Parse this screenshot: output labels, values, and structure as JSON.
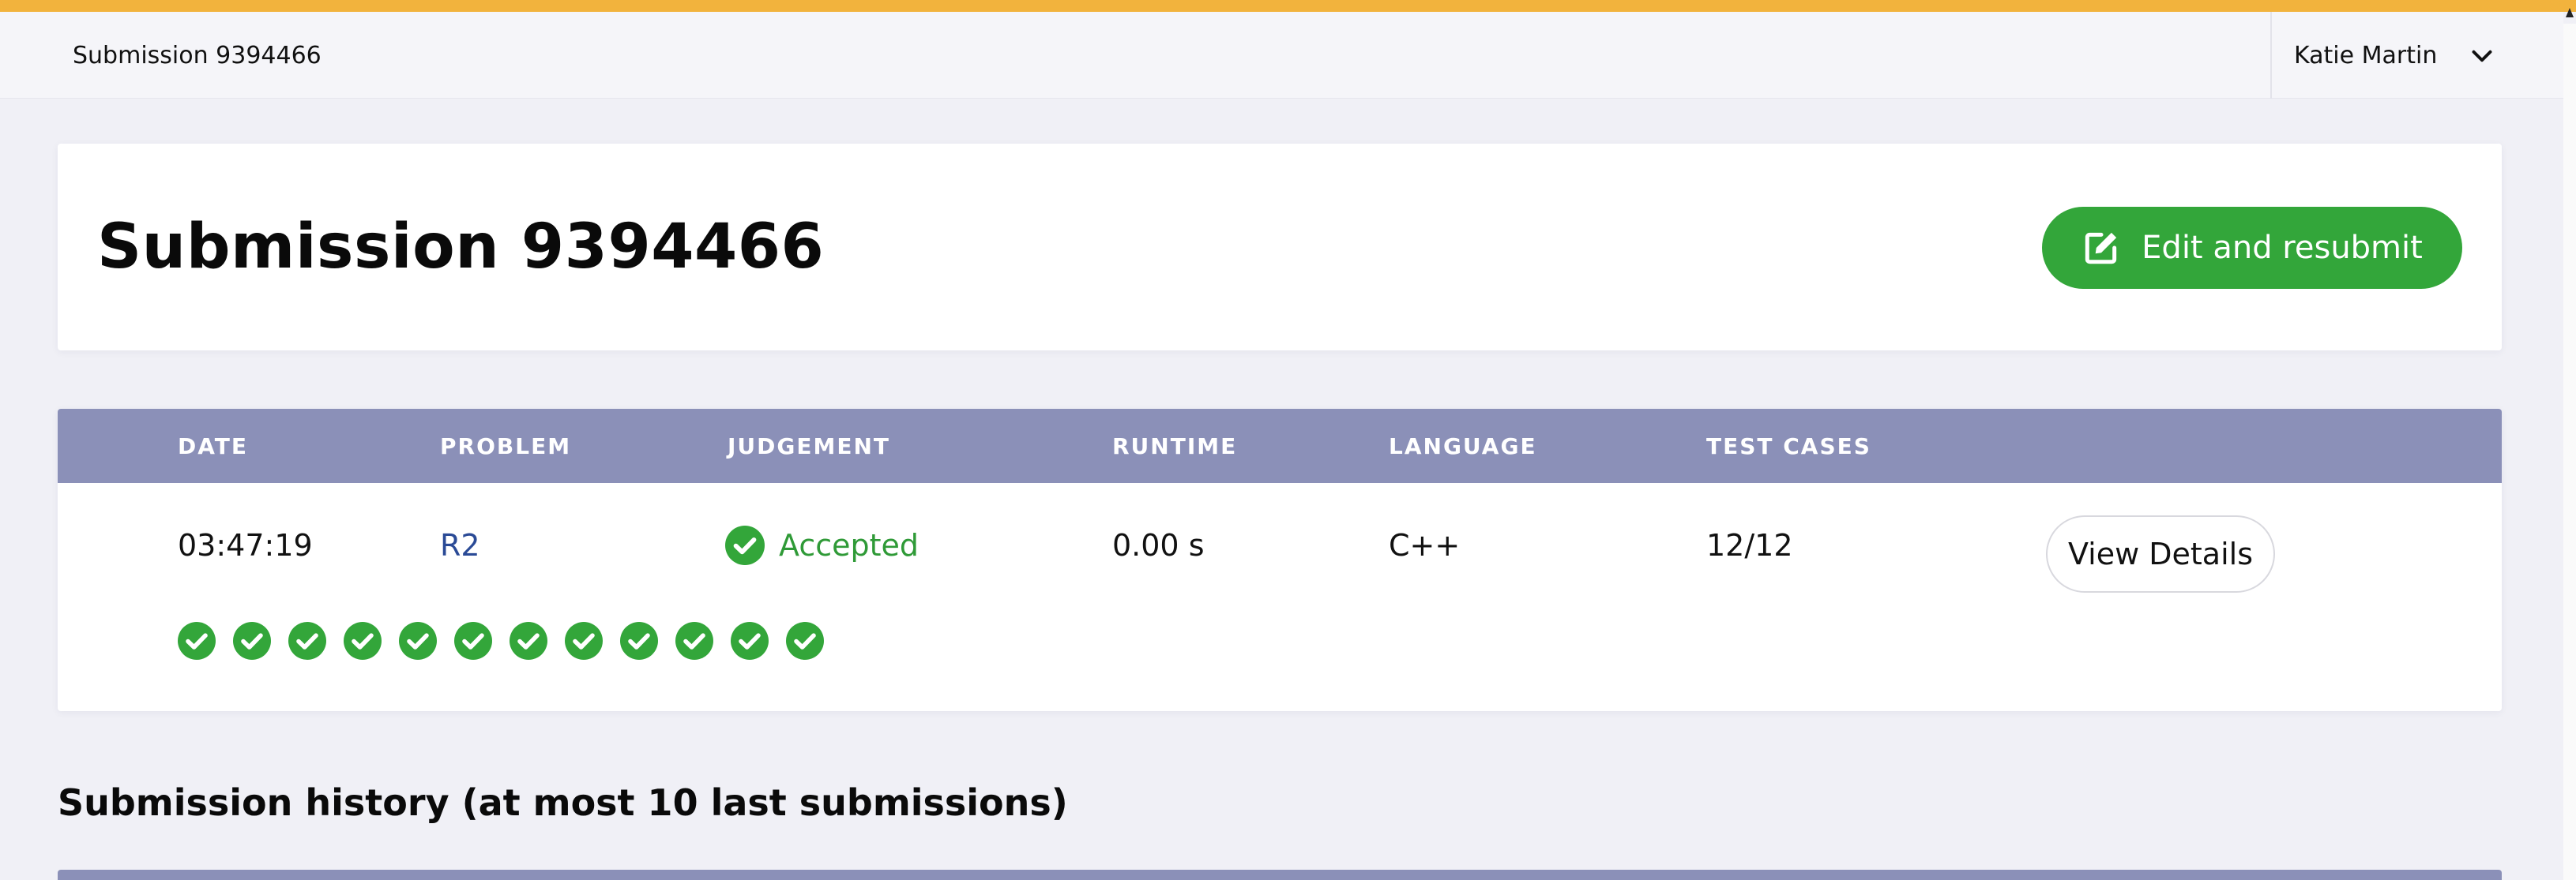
{
  "topbar": {
    "crumb": "Submission 9394466",
    "user_name": "Katie Martin"
  },
  "header": {
    "title": "Submission 9394466",
    "resubmit_label": "Edit and resubmit"
  },
  "table": {
    "headers": [
      "DATE",
      "PROBLEM",
      "JUDGEMENT",
      "RUNTIME",
      "LANGUAGE",
      "TEST CASES"
    ],
    "row": {
      "date": "03:47:19",
      "problem": "R2",
      "judgement": "Accepted",
      "runtime": "0.00 s",
      "language": "C++",
      "test_cases": "12/12",
      "details_label": "View Details"
    },
    "test_case_results": [
      "passed",
      "passed",
      "passed",
      "passed",
      "passed",
      "passed",
      "passed",
      "passed",
      "passed",
      "passed",
      "passed",
      "passed"
    ]
  },
  "history": {
    "title": "Submission history (at most 10 last submissions)"
  },
  "colors": {
    "accent_top": "#f2b33d",
    "success": "#33a63a",
    "table_header": "#8b90b8",
    "link": "#2a4a96"
  }
}
